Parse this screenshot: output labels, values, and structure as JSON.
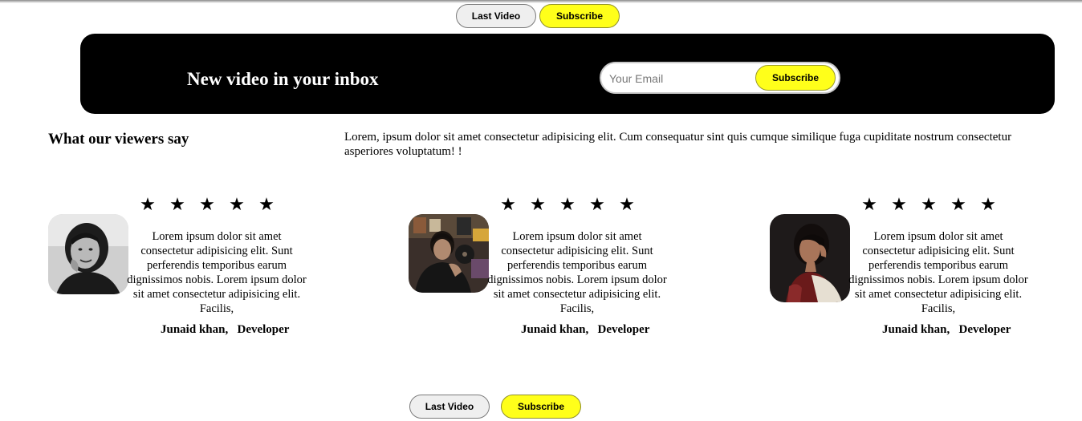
{
  "top_buttons": {
    "last_video": "Last Video",
    "subscribe": "Subscribe"
  },
  "banner": {
    "title": "New video in your inbox",
    "email_placeholder": "Your Email",
    "subscribe": "Subscribe"
  },
  "reviews_section": {
    "title": "What our viewers say",
    "description": "Lorem, ipsum dolor sit amet consectetur adipisicing elit. Cum consequatur sint quis cumque similique fuga cupiditate nostrum consectetur asperiores voluptatum! !"
  },
  "reviews": [
    {
      "rating": 5,
      "stars": "★★★★★",
      "text": "Lorem ipsum dolor sit amet consectetur adipisicing elit. Sunt perferendis temporibus earum dignissimos nobis. Lorem ipsum dolor sit amet consectetur adipisicing elit. Facilis,",
      "name": "Junaid khan,",
      "role": "Developer"
    },
    {
      "rating": 5,
      "stars": "★★★★★",
      "text": "Lorem ipsum dolor sit amet consectetur adipisicing elit. Sunt perferendis temporibus earum dignissimos nobis. Lorem ipsum dolor sit amet consectetur adipisicing elit. Facilis,",
      "name": "Junaid khan,",
      "role": "Developer"
    },
    {
      "rating": 5,
      "stars": "★★★★★",
      "text": "Lorem ipsum dolor sit amet consectetur adipisicing elit. Sunt perferendis temporibus earum dignissimos nobis. Lorem ipsum dolor sit amet consectetur adipisicing elit. Facilis,",
      "name": "Junaid khan,",
      "role": "Developer"
    }
  ],
  "bottom_buttons": {
    "last_video": "Last Video",
    "subscribe": "Subscribe"
  },
  "colors": {
    "accent_yellow": "#ffff1a",
    "banner_bg": "#000000",
    "button_light": "#efefef"
  }
}
